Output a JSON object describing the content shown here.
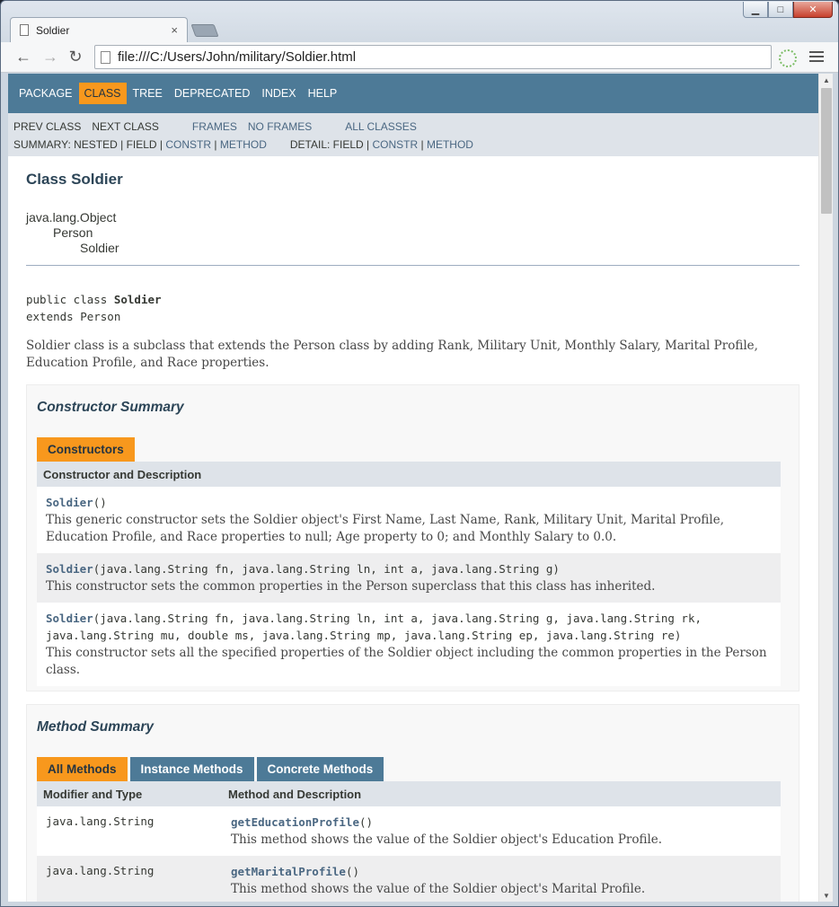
{
  "browser": {
    "tab_title": "Soldier",
    "tab_close": "×",
    "url": "file:///C:/Users/John/military/Soldier.html",
    "window_min": "▁",
    "window_max": "□",
    "window_close": "✕",
    "back": "←",
    "forward": "→",
    "reload": "↻"
  },
  "topnav": {
    "items": [
      "PACKAGE",
      "CLASS",
      "TREE",
      "DEPRECATED",
      "INDEX",
      "HELP"
    ],
    "active": "CLASS"
  },
  "subnav": {
    "prev_class": "PREV CLASS",
    "next_class": "NEXT CLASS",
    "frames": "FRAMES",
    "no_frames": "NO FRAMES",
    "all_classes": "ALL CLASSES",
    "summary_label": "SUMMARY: NESTED | FIELD |",
    "summary_constr": "CONSTR",
    "summary_sep": "|",
    "summary_method": "METHOD",
    "detail_label": "DETAIL: FIELD |",
    "detail_constr": "CONSTR",
    "detail_sep": "|",
    "detail_method": "METHOD"
  },
  "page": {
    "class_title": "Class Soldier",
    "inheritance": [
      "java.lang.Object",
      "Person",
      "Soldier"
    ],
    "decl_line1_prefix": "public class ",
    "decl_line1_name": "Soldier",
    "decl_line2": "extends Person",
    "description": "Soldier class is a subclass that extends the Person class by adding Rank, Military Unit, Monthly Salary, Marital Profile, Education Profile, and Race properties."
  },
  "constructor_summary": {
    "heading": "Constructor Summary",
    "caption": "Constructors",
    "column_header": "Constructor and Description",
    "rows": [
      {
        "name": "Soldier",
        "params": "()",
        "description": "This generic constructor sets the Soldier object's First Name, Last Name, Rank, Military Unit, Marital Profile, Education Profile, and Race properties to null; Age property to 0; and Monthly Salary to 0.0."
      },
      {
        "name": "Soldier",
        "params": "(java.lang.String fn, java.lang.String ln, int a, java.lang.String g)",
        "description": "This constructor sets the common properties in the Person superclass that this class has inherited."
      },
      {
        "name": "Soldier",
        "params": "(java.lang.String fn, java.lang.String ln, int a, java.lang.String g, java.lang.String rk, java.lang.String mu, double ms, java.lang.String mp, java.lang.String ep, java.lang.String re)",
        "description": "This constructor sets all the specified properties of the Soldier object including the common properties in the Person class."
      }
    ]
  },
  "method_summary": {
    "heading": "Method Summary",
    "tabs": [
      "All Methods",
      "Instance Methods",
      "Concrete Methods"
    ],
    "col1": "Modifier and Type",
    "col2": "Method and Description",
    "rows": [
      {
        "type": "java.lang.String",
        "name": "getEducationProfile",
        "params": "()",
        "description": "This method shows the value of the Soldier object's Education Profile."
      },
      {
        "type": "java.lang.String",
        "name": "getMaritalProfile",
        "params": "()",
        "description": "This method shows the value of the Soldier object's Marital Profile."
      }
    ]
  },
  "colors": {
    "nav_blue": "#4D7A97",
    "accent_orange": "#F8981D",
    "subnav_gray": "#dee3e9"
  }
}
